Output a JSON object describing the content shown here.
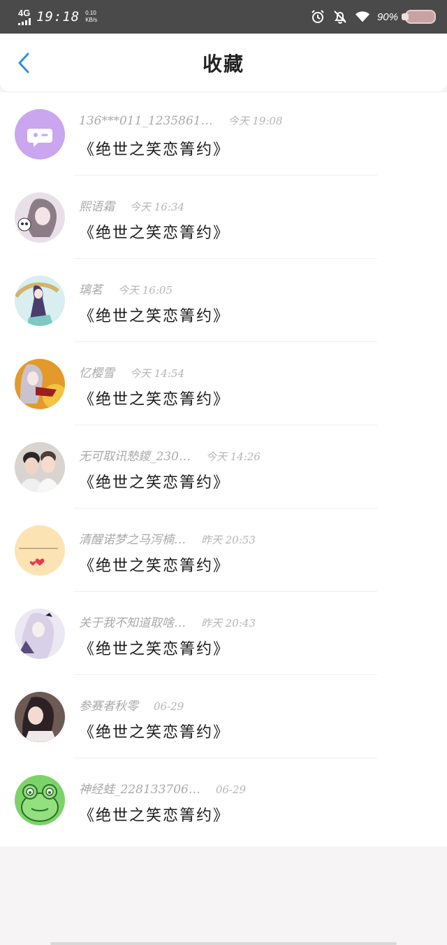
{
  "status_bar": {
    "network": "4G",
    "time": "19:18",
    "speed_value": "0.10",
    "speed_unit": "KB/s",
    "battery": "90%",
    "icons": [
      "signal-icon",
      "alarm-icon",
      "notifications-off-icon",
      "wifi-icon",
      "battery-icon"
    ]
  },
  "header": {
    "back_icon": "chevron-left-icon",
    "title": "收藏"
  },
  "colors": {
    "accent": "#2f8fe8",
    "status_bar_bg": "#4a4a4a",
    "name_gray": "#a9a9a9"
  },
  "favorites": [
    {
      "name": "136***011_1235861…",
      "time": "今天 19:08",
      "book": "《绝世之笑恋箐约》",
      "avatar": "chat-bubble-avatar"
    },
    {
      "name": "熙语霜",
      "time": "今天 16:34",
      "book": "《绝世之笑恋箐约》",
      "avatar": "anime-girl-panda-avatar"
    },
    {
      "name": "璃茗",
      "time": "今天 16:05",
      "book": "《绝世之笑恋箐约》",
      "avatar": "anime-umbrella-avatar"
    },
    {
      "name": "忆樱雪",
      "time": "今天 14:54",
      "book": "《绝世之笑恋箐约》",
      "avatar": "anime-fire-avatar"
    },
    {
      "name": "无可取讯慹鑁_230…",
      "time": "今天 14:26",
      "book": "《绝世之笑恋箐约》",
      "avatar": "two-boys-photo-avatar"
    },
    {
      "name": "清醒诺梦之马泻楠…",
      "time": "昨天 20:53",
      "book": "《绝世之笑恋箐约》",
      "avatar": "text-hearts-avatar"
    },
    {
      "name": "关于我不知道取啥…",
      "time": "昨天 20:43",
      "book": "《绝世之笑恋箐约》",
      "avatar": "anime-white-hair-avatar"
    },
    {
      "name": "参赛者秋零",
      "time": "06-29",
      "book": "《绝世之笑恋箐约》",
      "avatar": "anime-dark-hair-avatar"
    },
    {
      "name": "神经蛙_228133706…",
      "time": "06-29",
      "book": "《绝世之笑恋箐约》",
      "avatar": "green-frog-avatar"
    }
  ]
}
